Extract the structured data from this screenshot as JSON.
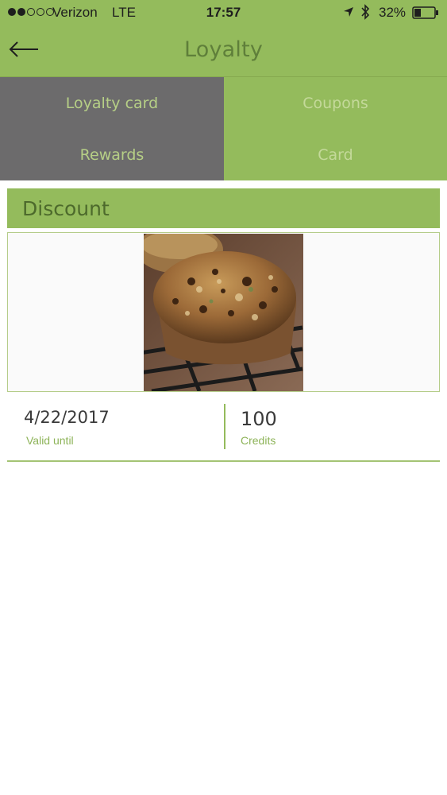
{
  "status_bar": {
    "carrier": "Verizon",
    "network": "LTE",
    "time": "17:57",
    "battery_percent": "32%",
    "battery_level": 0.32,
    "signal_strength": 2,
    "signal_max": 5,
    "icons": [
      "location-arrow-icon",
      "bluetooth-icon",
      "battery-icon"
    ]
  },
  "header": {
    "title": "Loyalty",
    "back_icon": "left-arrow-icon"
  },
  "tabs": [
    {
      "label": "Loyalty card",
      "active": true
    },
    {
      "label": "Coupons",
      "active": false
    },
    {
      "label": "Rewards",
      "active": true
    },
    {
      "label": "Card",
      "active": false
    }
  ],
  "coupon": {
    "section_title": "Discount",
    "image_subject": "muffin",
    "valid_date": "4/22/2017",
    "valid_label": "Valid until",
    "credits_value": "100",
    "credits_label": "Credits"
  },
  "colors": {
    "brand_green": "#94bb5c",
    "active_tab_gray": "#6c6b6c",
    "label_green": "#8db358"
  }
}
